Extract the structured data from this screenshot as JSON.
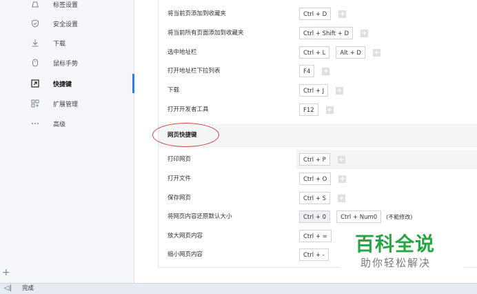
{
  "sidebar": {
    "items": [
      {
        "label": "标签设置",
        "icon": "tab-settings-icon"
      },
      {
        "label": "安全设置",
        "icon": "shield-icon"
      },
      {
        "label": "下载",
        "icon": "download-icon"
      },
      {
        "label": "鼠标手势",
        "icon": "mouse-icon"
      },
      {
        "label": "快捷键",
        "icon": "shortcut-icon",
        "active": true
      },
      {
        "label": "扩展管理",
        "icon": "extensions-icon"
      },
      {
        "label": "高级",
        "icon": "more-icon"
      }
    ],
    "add_label": "+"
  },
  "shortcuts_top": [
    {
      "label": "将当前页添加到收藏夹",
      "keys": [
        "Ctrl + D"
      ]
    },
    {
      "label": "将当前所有页面添加到收藏夹",
      "keys": [
        "Ctrl + Shift + D"
      ]
    },
    {
      "label": "选中地址栏",
      "keys": [
        "Ctrl + L",
        "Alt + D"
      ]
    },
    {
      "label": "打开地址栏下拉列表",
      "keys": [
        "F4"
      ]
    },
    {
      "label": "下载",
      "keys": [
        "Ctrl + J"
      ]
    },
    {
      "label": "打开开发者工具",
      "keys": [
        "F12"
      ]
    }
  ],
  "section": {
    "title": "网页快捷键"
  },
  "shortcuts_page": [
    {
      "label": "打印网页",
      "keys": [
        "Ctrl + P"
      ]
    },
    {
      "label": "打开文件",
      "keys": [
        "Ctrl + O"
      ]
    },
    {
      "label": "保存网页",
      "keys": [
        "Ctrl + S"
      ]
    },
    {
      "label": "将网页内容还原默认大小",
      "keys": [
        "Ctrl + 0",
        "Ctrl + Num0"
      ],
      "note": "(不能修改)"
    },
    {
      "label": "放大网页内容",
      "keys": [
        "Ctrl + ="
      ]
    },
    {
      "label": "缩小网页内容",
      "keys": [
        "Ctrl + -"
      ]
    }
  ],
  "add_key_label": "+",
  "watermark": {
    "title": "百科全说",
    "subtitle": "助你轻松解决"
  },
  "status": {
    "text": "完成",
    "icon": "panel-toggle-icon"
  },
  "colors": {
    "accent": "#2f7fdb",
    "annotation": "#d6413d",
    "watermark": "#27a543"
  }
}
